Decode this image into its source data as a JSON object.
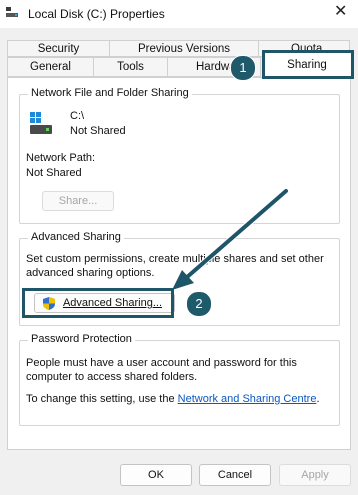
{
  "window": {
    "title": "Local Disk (C:) Properties",
    "close_glyph": "✕"
  },
  "tabs": {
    "row_back": [
      "Security",
      "Previous Versions",
      "Quota"
    ],
    "row_front": [
      "General",
      "Tools",
      "Hardware",
      "Sharing"
    ],
    "active": "Sharing"
  },
  "network_sharing": {
    "title": "Network File and Folder Sharing",
    "drive_path": "C:\\",
    "drive_status": "Not Shared",
    "network_path_label": "Network Path:",
    "network_path_value": "Not Shared",
    "share_button": "Share..."
  },
  "advanced_sharing": {
    "title": "Advanced Sharing",
    "description_line1": "Set custom permissions, create multiple shares and set other",
    "description_line2": "advanced sharing options.",
    "button": "Advanced Sharing..."
  },
  "password_protection": {
    "title": "Password Protection",
    "line1": "People must have a user account and password for this",
    "line2": "computer to access shared folders.",
    "line3_prefix": "To change this setting, use the ",
    "line3_link": "Network and Sharing Centre",
    "line3_suffix": "."
  },
  "footer": {
    "ok": "OK",
    "cancel": "Cancel",
    "apply": "Apply"
  },
  "callouts": {
    "badge1": "1",
    "badge2": "2"
  },
  "colors": {
    "callout": "#1e5568",
    "link": "#0a58c2"
  }
}
